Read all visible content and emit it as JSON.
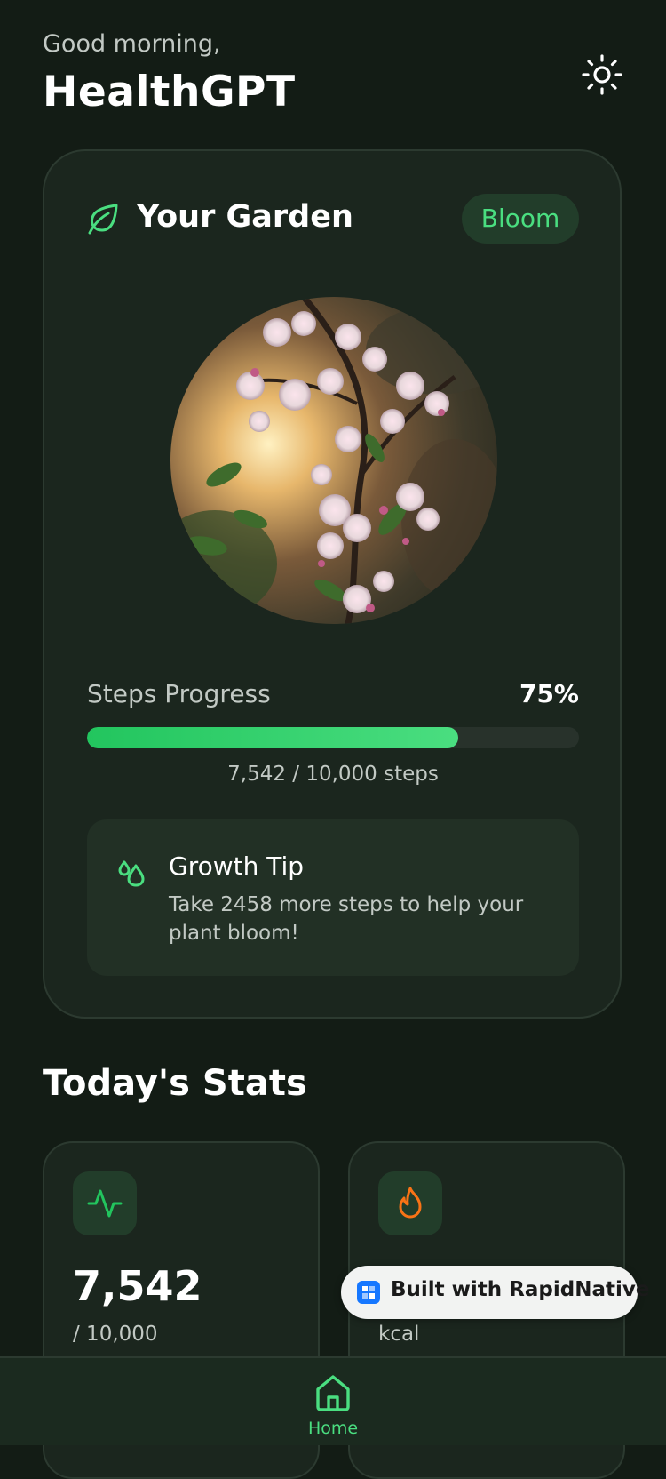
{
  "header": {
    "greeting": "Good morning,",
    "title": "HealthGPT",
    "theme_icon": "sun-icon"
  },
  "garden": {
    "title": "Your Garden",
    "title_icon": "leaf-icon",
    "stage": "Bloom",
    "image": "blossom-branch-photo",
    "steps_label": "Steps Progress",
    "steps_percent": "75%",
    "progress_fraction": 0.754,
    "steps_count": "7,542 / 10,000 steps",
    "tip": {
      "icon": "droplets-icon",
      "title": "Growth Tip",
      "text": "Take 2458 more steps to help your plant bloom!"
    }
  },
  "stats": {
    "title": "Today's Stats",
    "cards": [
      {
        "icon": "activity-icon",
        "value": "7,542",
        "sub": "/ 10,000"
      },
      {
        "icon": "flame-icon",
        "value": "",
        "sub": "kcal"
      }
    ]
  },
  "badge": {
    "text": "Built with RapidNative"
  },
  "nav": {
    "home_label": "Home",
    "home_icon": "home-icon"
  },
  "colors": {
    "background": "#131c15",
    "card": "#1b261e",
    "accent": "#4ade80",
    "flame": "#f97316"
  }
}
